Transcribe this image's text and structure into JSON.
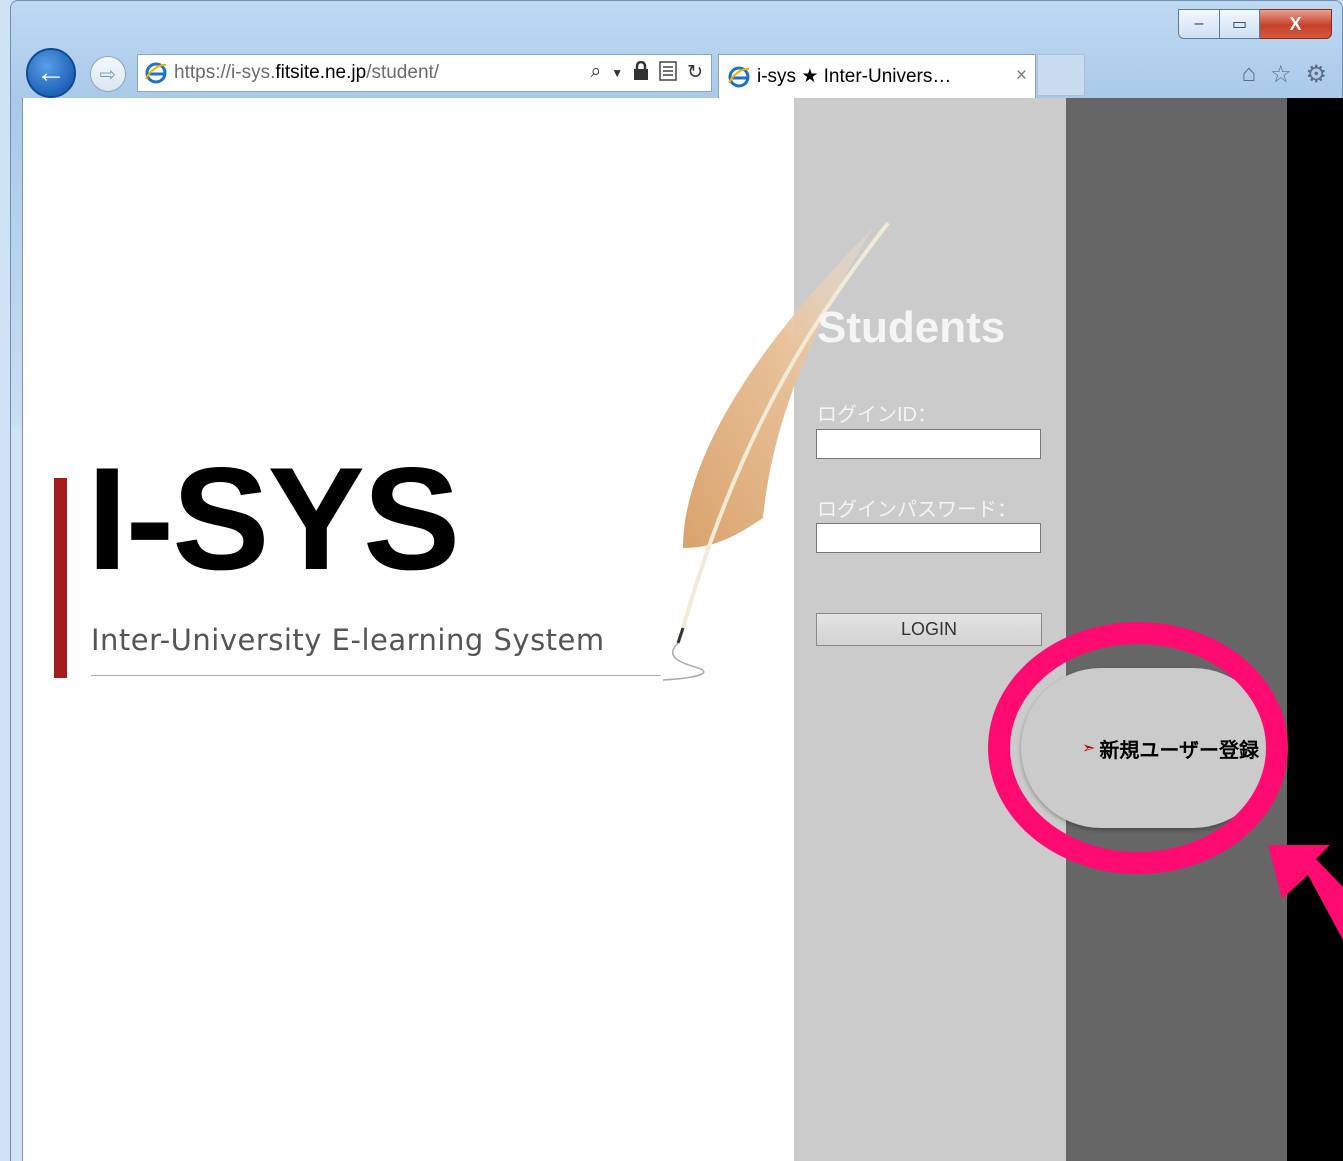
{
  "browser": {
    "address_url_scheme": "https://",
    "address_url_domain_pre": "i-sys.",
    "address_url_domain": "fitsite.ne.jp",
    "address_url_path": "/student/",
    "tab_title": "i-sys  ★  Inter-Univers…",
    "caption_min": "–",
    "caption_max": "▭",
    "caption_close": "X",
    "back_glyph": "←",
    "forward_glyph": "⇨",
    "tab_close_glyph": "×",
    "icons": [
      "back-icon",
      "forward-icon",
      "ie-logo-icon",
      "search-icon",
      "dropdown-icon",
      "lock-icon",
      "compatibility-icon",
      "refresh-icon",
      "home-icon",
      "favorites-star-icon",
      "gear-icon"
    ]
  },
  "page": {
    "logo_title": "I-SYS",
    "logo_subtitle": "Inter-University E-learning System",
    "heading": "Students",
    "login_id_label": "ログインID：",
    "login_password_label": "ログインパスワード：",
    "login_id_value": "",
    "login_password_value": "",
    "login_button": "LOGIN",
    "register_label": "新規ユーザー登録",
    "register_arrow": "➣",
    "colors": {
      "logo_bar": "#a51c1c",
      "column_light": "#cbcbcb",
      "column_dark": "#666666",
      "annotation": "#ff0a71"
    }
  }
}
